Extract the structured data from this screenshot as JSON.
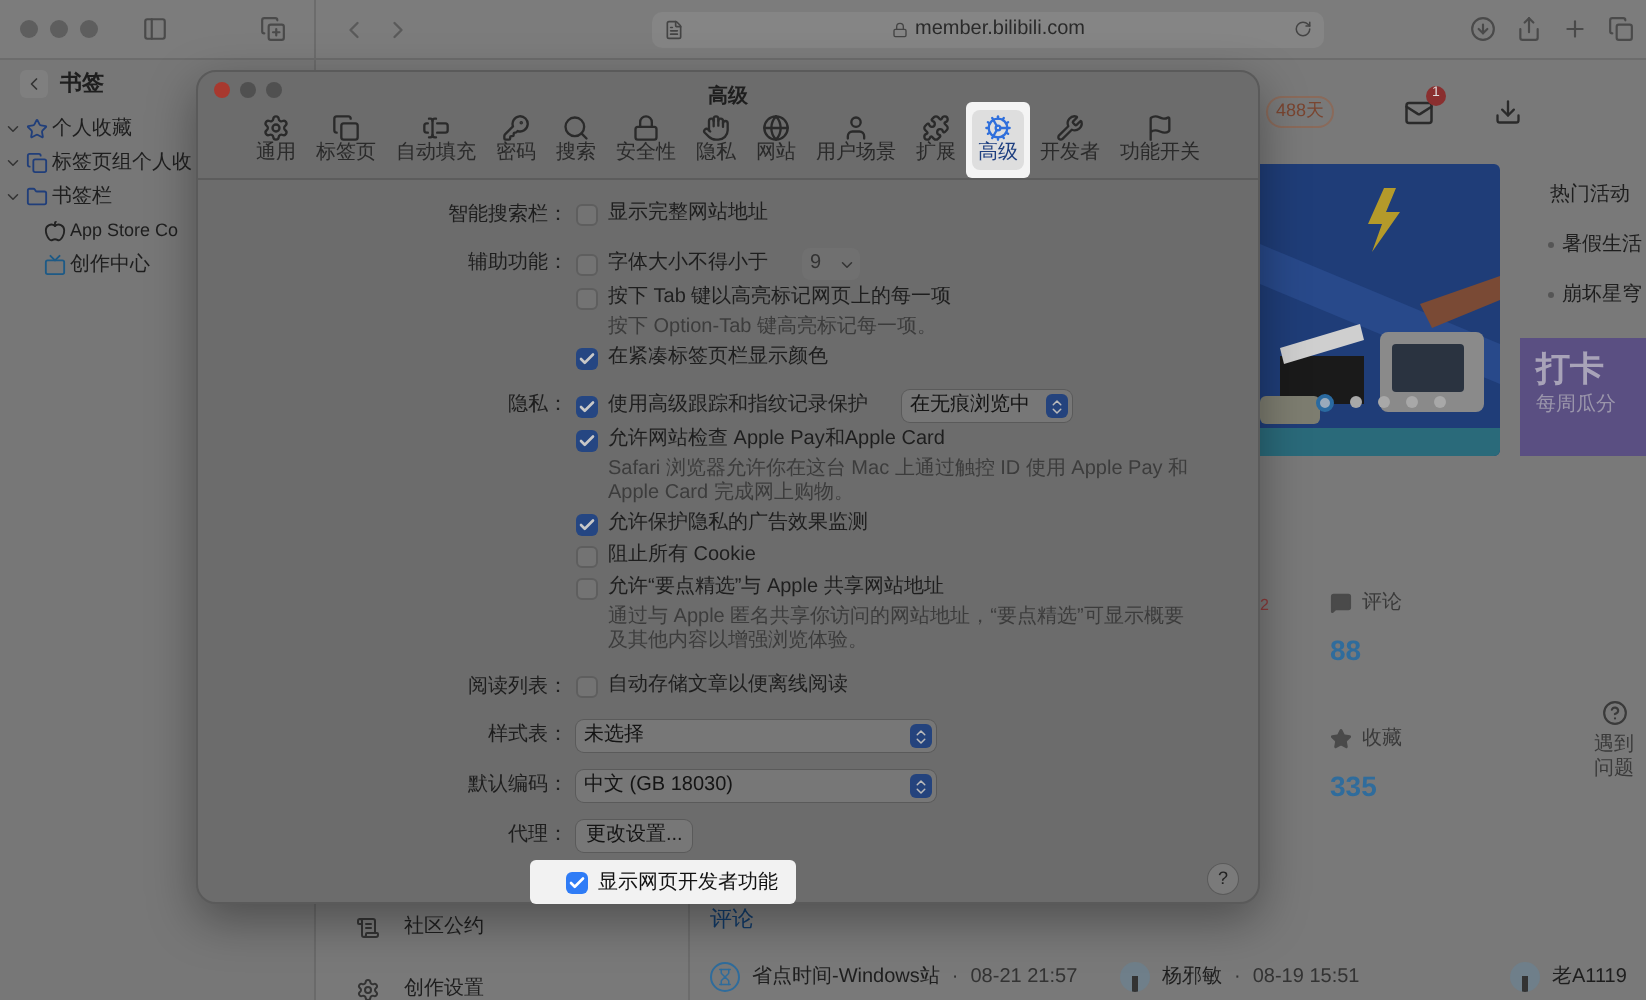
{
  "browser": {
    "sidebar_title": "书签",
    "address": "member.bilibili.com"
  },
  "bookmarks": [
    {
      "label": "个人收藏",
      "kind": "star",
      "expanded": true
    },
    {
      "label": "标签页组个人收",
      "kind": "tabs",
      "expanded": true
    },
    {
      "label": "书签栏",
      "kind": "folder",
      "expanded": true,
      "children": [
        {
          "label": "App Store Co",
          "kind": "apple"
        },
        {
          "label": "创作中心",
          "kind": "tv"
        }
      ]
    }
  ],
  "page": {
    "streak": "488天",
    "mail_badge": "1",
    "hot_title": "热门活动",
    "hot_items": [
      "暑假生活",
      "崩坏星穹"
    ],
    "promo_title": "打卡",
    "promo_subtitle": "每周瓜分",
    "banner": {
      "kind": "picture"
    },
    "carousel_dots": [
      {
        "selected": true
      },
      {
        "selected": false
      },
      {
        "selected": false
      },
      {
        "selected": false
      },
      {
        "selected": false
      }
    ],
    "partial_number": "2",
    "stats": [
      {
        "label": "评论",
        "value": "88",
        "kind": "comment"
      },
      {
        "label": "收藏",
        "value": "335",
        "kind": "star"
      }
    ],
    "help_label": "遇到问题",
    "nav": [
      {
        "label": "社区公约",
        "kind": "rules"
      },
      {
        "label": "创作设置",
        "kind": "gear"
      }
    ],
    "comments_title": "评论",
    "comments": [
      {
        "author": "省点时间-Windows站",
        "separator": "·",
        "time": "08-21 21:57",
        "kind": "hourglass"
      },
      {
        "author": "杨邪敏",
        "separator": "·",
        "time": "08-19 15:51"
      },
      {
        "author": "老A1119"
      }
    ]
  },
  "dialog": {
    "title": "高级",
    "tabs": [
      {
        "label": "通用",
        "kind": "general",
        "selected": false
      },
      {
        "label": "标签页",
        "kind": "tabs",
        "selected": false
      },
      {
        "label": "自动填充",
        "kind": "autofill",
        "selected": false
      },
      {
        "label": "密码",
        "kind": "passwords",
        "selected": false
      },
      {
        "label": "搜索",
        "kind": "search",
        "selected": false
      },
      {
        "label": "安全性",
        "kind": "security",
        "selected": false
      },
      {
        "label": "隐私",
        "kind": "privacy",
        "selected": false
      },
      {
        "label": "网站",
        "kind": "websites",
        "selected": false
      },
      {
        "label": "用户场景",
        "kind": "profiles",
        "selected": false
      },
      {
        "label": "扩展",
        "kind": "extensions",
        "selected": false
      },
      {
        "label": "高级",
        "kind": "advanced",
        "selected": true
      },
      {
        "label": "开发者",
        "kind": "developer",
        "selected": false
      },
      {
        "label": "功能开关",
        "kind": "flags",
        "selected": false
      }
    ],
    "sections": [
      {
        "label": "智能搜索栏：",
        "items": [
          {
            "kind": "checkbox",
            "label": "显示完整网站地址",
            "checked": false
          }
        ]
      },
      {
        "label": "辅助功能：",
        "items": [
          {
            "kind": "checkbox",
            "label": "字体大小不得小于",
            "checked": false,
            "popup": {
              "value": "9",
              "disabled": true
            }
          },
          {
            "kind": "checkbox",
            "label": "按下 Tab 键以高亮标记网页上的每一项",
            "checked": false
          },
          {
            "kind": "hint",
            "text": "按下 Option-Tab 键高亮标记每一项。"
          },
          {
            "kind": "checkbox",
            "label": "在紧凑标签页栏显示颜色",
            "checked": true
          }
        ]
      },
      {
        "label": "隐私：",
        "items": [
          {
            "kind": "checkbox",
            "label": "使用高级跟踪和指纹记录保护",
            "checked": true,
            "popup": {
              "value": "在无痕浏览中",
              "disabled": false
            }
          },
          {
            "kind": "checkbox",
            "label": "允许网站检查 Apple Pay和Apple Card",
            "checked": true
          },
          {
            "kind": "hint",
            "text": "Safari 浏览器允许你在这台 Mac 上通过触控 ID 使用 Apple Pay 和 Apple Card 完成网上购物。"
          },
          {
            "kind": "checkbox",
            "label": "允许保护隐私的广告效果监测",
            "checked": true
          },
          {
            "kind": "checkbox",
            "label": "阻止所有 Cookie",
            "checked": false
          },
          {
            "kind": "checkbox",
            "label": "允许“要点精选”与 Apple 共享网站地址",
            "checked": false
          },
          {
            "kind": "hint",
            "text": "通过与 Apple 匿名共享你访问的网站地址，“要点精选”可显示概要及其他内容以增强浏览体验。"
          }
        ]
      },
      {
        "label": "阅读列表：",
        "items": [
          {
            "kind": "checkbox",
            "label": "自动存储文章以便离线阅读",
            "checked": false
          }
        ]
      },
      {
        "label": "样式表：",
        "items": [
          {
            "kind": "popup",
            "value": "未选择"
          }
        ]
      },
      {
        "label": "默认编码：",
        "items": [
          {
            "kind": "popup",
            "value": "中文 (GB 18030)"
          }
        ]
      },
      {
        "label": "代理：",
        "items": [
          {
            "kind": "button",
            "label": "更改设置..."
          }
        ]
      }
    ],
    "developer_option": {
      "label": "显示网页开发者功能",
      "checked": true
    },
    "help": "?"
  }
}
